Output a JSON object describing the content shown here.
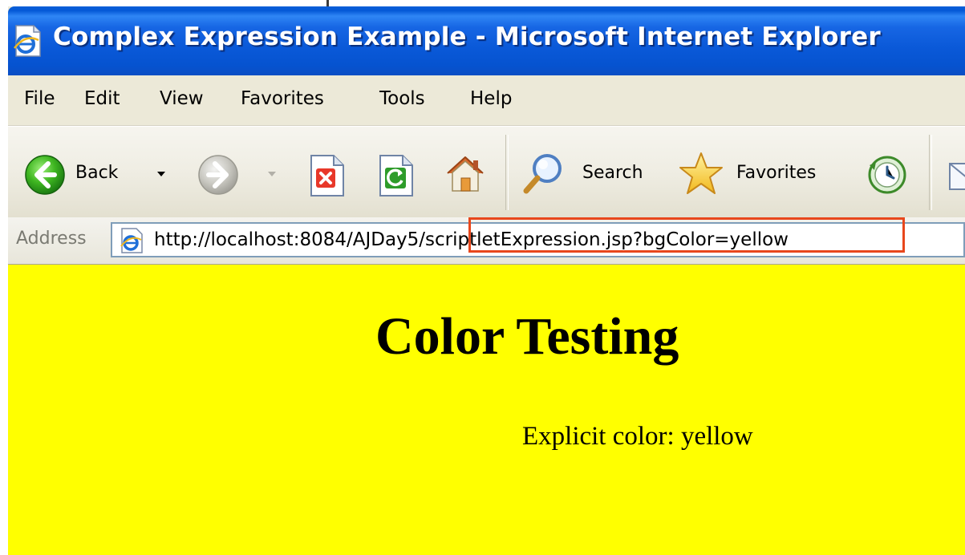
{
  "window": {
    "title": "Complex Expression Example - Microsoft Internet Explorer",
    "title_icon": "ie-page-icon"
  },
  "menu": {
    "items": [
      "File",
      "Edit",
      "View",
      "Favorites",
      "Tools",
      "Help"
    ]
  },
  "toolbar": {
    "back_label": "Back",
    "back_icon": "back-arrow-icon",
    "forward_icon": "forward-arrow-icon",
    "stop_icon": "stop-icon",
    "refresh_icon": "refresh-icon",
    "home_icon": "home-icon",
    "search_label": "Search",
    "search_icon": "search-icon",
    "favorites_label": "Favorites",
    "favorites_icon": "favorites-star-icon",
    "history_icon": "history-icon"
  },
  "address": {
    "label": "Address",
    "url": "http://localhost:8084/AJDay5/scriptletExpression.jsp?bgColor=yellow",
    "page_icon": "ie-page-icon"
  },
  "page": {
    "heading": "Color Testing",
    "text": "Explicit color: yellow",
    "background_color": "#ffff00"
  },
  "colors": {
    "titlebar": "#0a59d8",
    "highlight": "#e8471c",
    "chrome": "#ece9d8"
  }
}
